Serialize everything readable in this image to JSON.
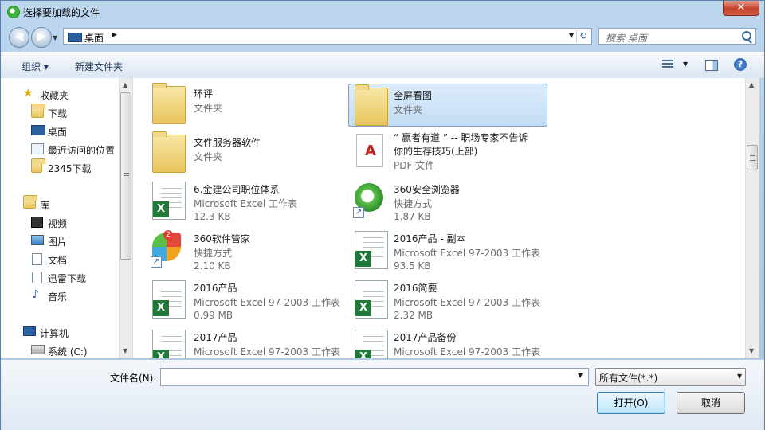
{
  "window": {
    "title": "选择要加载的文件",
    "close_label": "✕"
  },
  "nav": {
    "back": "◀",
    "forward": "▶"
  },
  "address": {
    "location": "桌面",
    "separator": "▶"
  },
  "search": {
    "placeholder": "搜索 桌面"
  },
  "toolbar": {
    "organize": "组织 ▾",
    "new_folder": "新建文件夹",
    "help": "?"
  },
  "sidebar": {
    "favorites": "收藏夹",
    "fav_items": [
      "下载",
      "桌面",
      "最近访问的位置",
      "2345下载"
    ],
    "libraries": "库",
    "lib_items": [
      "视频",
      "图片",
      "文档",
      "迅雷下载",
      "音乐"
    ],
    "computer": "计算机",
    "comp_items": [
      "系统 (C:)"
    ]
  },
  "files": [
    {
      "name": "环评",
      "type": "文件夹",
      "size": ""
    },
    {
      "name": "全屏看图",
      "type": "文件夹",
      "size": ""
    },
    {
      "name": "文件服务器软件",
      "type": "文件夹",
      "size": ""
    },
    {
      "name": "“ 赢者有道 ” -- 职场专家不告诉",
      "name2": "你的生存技巧(上部)",
      "type": "PDF 文件",
      "size": ""
    },
    {
      "name": "6.金建公司职位体系",
      "type": "Microsoft Excel 工作表",
      "size": "12.3 KB"
    },
    {
      "name": "360安全浏览器",
      "type": "快捷方式",
      "size": "1.87 KB"
    },
    {
      "name": "360软件管家",
      "type": "快捷方式",
      "size": "2.10 KB",
      "badge": "2"
    },
    {
      "name": "2016产品 - 副本",
      "type": "Microsoft Excel 97-2003 工作表",
      "size": "93.5 KB"
    },
    {
      "name": "2016产品",
      "type": "Microsoft Excel 97-2003 工作表",
      "size": "0.99 MB"
    },
    {
      "name": "2016简要",
      "type": "Microsoft Excel 97-2003 工作表",
      "size": "2.32 MB"
    },
    {
      "name": "2017产品",
      "type": "Microsoft Excel 97-2003 工作表",
      "size": ""
    },
    {
      "name": "2017产品备份",
      "type": "Microsoft Excel 97-2003 工作表",
      "size": ""
    }
  ],
  "bottom": {
    "filename_label": "文件名(N):",
    "filename_value": "",
    "filter": "所有文件(*.*)",
    "open": "打开(O)",
    "cancel": "取消"
  }
}
